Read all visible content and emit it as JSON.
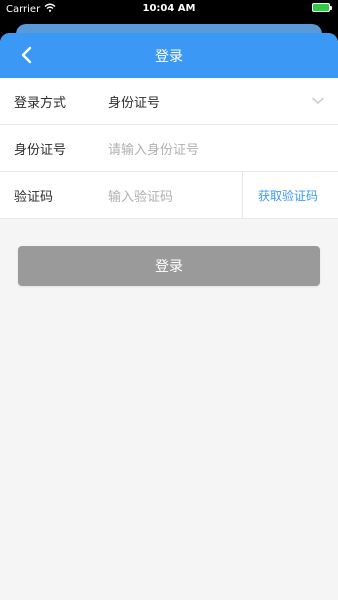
{
  "status_bar": {
    "carrier": "Carrier",
    "time": "10:04 AM"
  },
  "nav": {
    "title": "登录",
    "back_icon": "chevron-left-icon"
  },
  "form": {
    "login_method": {
      "label": "登录方式",
      "value": "身份证号",
      "icon": "chevron-down-icon"
    },
    "id_number": {
      "label": "身份证号",
      "placeholder": "请输入身份证号"
    },
    "verification_code": {
      "label": "验证码",
      "placeholder": "输入验证码",
      "get_code_label": "获取验证码"
    }
  },
  "actions": {
    "login_label": "登录"
  },
  "colors": {
    "primary": "#3b98f5",
    "button_disabled": "#9a9a9a",
    "background": "#f5f5f5"
  }
}
